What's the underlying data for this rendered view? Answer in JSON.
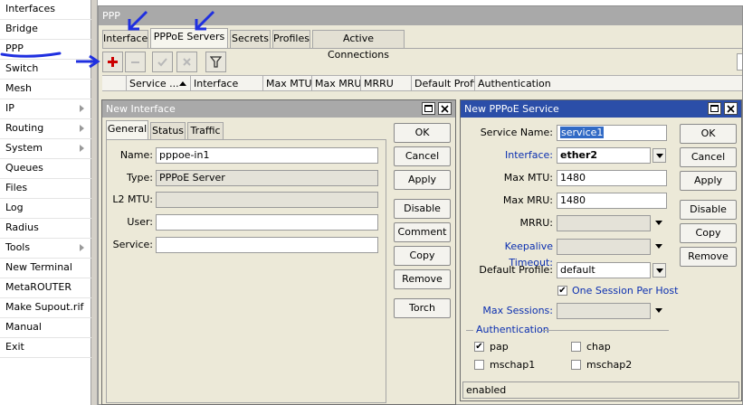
{
  "sidebar": {
    "items": [
      {
        "label": "Interfaces",
        "submenu": false
      },
      {
        "label": "Bridge",
        "submenu": false
      },
      {
        "label": "PPP",
        "submenu": false
      },
      {
        "label": "Switch",
        "submenu": false
      },
      {
        "label": "Mesh",
        "submenu": false
      },
      {
        "label": "IP",
        "submenu": true
      },
      {
        "label": "Routing",
        "submenu": true
      },
      {
        "label": "System",
        "submenu": true
      },
      {
        "label": "Queues",
        "submenu": false
      },
      {
        "label": "Files",
        "submenu": false
      },
      {
        "label": "Log",
        "submenu": false
      },
      {
        "label": "Radius",
        "submenu": false
      },
      {
        "label": "Tools",
        "submenu": true
      },
      {
        "label": "New Terminal",
        "submenu": false
      },
      {
        "label": "MetaROUTER",
        "submenu": false
      },
      {
        "label": "Make Supout.rif",
        "submenu": false
      },
      {
        "label": "Manual",
        "submenu": false
      },
      {
        "label": "Exit",
        "submenu": false
      }
    ]
  },
  "ppp_window": {
    "title": "PPP",
    "tabs": [
      "Interface",
      "PPPoE Servers",
      "Secrets",
      "Profiles",
      "Active Connections"
    ],
    "active_tab": "PPPoE Servers",
    "columns": [
      "Service ...",
      "Interface",
      "Max MTU",
      "Max MRU",
      "MRRU",
      "Default Profile",
      "Authentication"
    ]
  },
  "new_interface": {
    "title": "New Interface",
    "tabs": [
      "General",
      "Status",
      "Traffic"
    ],
    "fields": {
      "name_label": "Name:",
      "name_value": "pppoe-in1",
      "type_label": "Type:",
      "type_value": "PPPoE Server",
      "l2mtu_label": "L2 MTU:",
      "l2mtu_value": "",
      "user_label": "User:",
      "user_value": "",
      "service_label": "Service:",
      "service_value": ""
    },
    "buttons": [
      "OK",
      "Cancel",
      "Apply",
      "Disable",
      "Comment",
      "Copy",
      "Remove",
      "Torch"
    ]
  },
  "new_pppoe": {
    "title": "New PPPoE Service",
    "fields": {
      "service_name_label": "Service Name:",
      "service_name_value": "service1",
      "interface_label": "Interface:",
      "interface_value": "ether2",
      "max_mtu_label": "Max MTU:",
      "max_mtu_value": "1480",
      "max_mru_label": "Max MRU:",
      "max_mru_value": "1480",
      "mrru_label": "MRRU:",
      "mrru_value": "",
      "keepalive_label": "Keepalive Timeout:",
      "keepalive_value": "",
      "default_profile_label": "Default Profile:",
      "default_profile_value": "default",
      "one_session_label": "One Session Per Host",
      "max_sessions_label": "Max Sessions:",
      "max_sessions_value": ""
    },
    "authentication_label": "Authentication",
    "auth": [
      {
        "label": "pap",
        "checked": true
      },
      {
        "label": "chap",
        "checked": false
      },
      {
        "label": "mschap1",
        "checked": false
      },
      {
        "label": "mschap2",
        "checked": false
      }
    ],
    "buttons": [
      "OK",
      "Cancel",
      "Apply",
      "Disable",
      "Copy",
      "Remove"
    ],
    "status": "enabled"
  },
  "colors": {
    "active_title": "#2b4ea8",
    "inactive_title": "#a9a9a9",
    "annotation_arrow": "#1f2fe0",
    "add_icon": "#cc0000"
  },
  "icons": [
    "plus-icon",
    "minus-icon",
    "check-icon",
    "cross-icon",
    "filter-icon",
    "annotation-arrow-icon"
  ]
}
